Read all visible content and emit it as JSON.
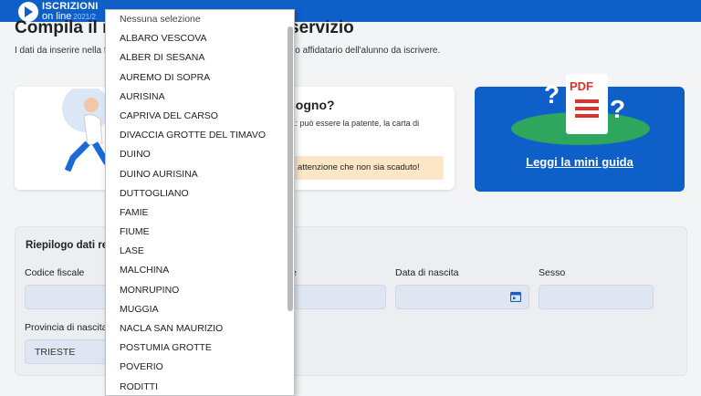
{
  "header": {
    "logo_line1": "ISCRIZIONI",
    "logo_line2": "on line",
    "logo_year": "2021/2"
  },
  "page": {
    "title_left": "Compila il m",
    "title_right": "servizio",
    "subtitle_left": "I dati da inserire nella f",
    "subtitle_right": "ore o affidatario dell'alunno da iscrivere."
  },
  "info": {
    "title": "sogno?",
    "text": "tà: può essere la patente, la carta di",
    "text2": "",
    "warning": "ai attenzione che non sia scaduto!"
  },
  "guide": {
    "link": "Leggi la mini guida",
    "pdf_label": "PDF"
  },
  "summary": {
    "title": "Riepilogo dati reg",
    "codice_fiscale_label": "Codice fiscale",
    "cognome_label_fragment": "e",
    "data_nascita_label": "Data di nascita",
    "sesso_label": "Sesso",
    "provincia_label": "Provincia di nascita",
    "provincia_value": "TRIESTE"
  },
  "dropdown": {
    "options": [
      "Nessuna selezione",
      "ALBARO VESCOVA",
      "ALBER DI SESANA",
      "AUREMO DI SOPRA",
      "AURISINA",
      "CAPRIVA DEL CARSO",
      "DIVACCIA GROTTE DEL TIMAVO",
      "DUINO",
      "DUINO AURISINA",
      "DUTTOGLIANO",
      "FAMIE",
      "FIUME",
      "LASE",
      "MALCHINA",
      "MONRUPINO",
      "MUGGIA",
      "NACLA SAN MAURIZIO",
      "POSTUMIA GROTTE",
      "POVERIO",
      "RODITTI"
    ]
  },
  "colors": {
    "brand_blue": "#0f5fc9",
    "warning_bg": "#fbe7c6",
    "input_bg": "#dfe6f2"
  },
  "icons": [
    "logo-arrow-icon",
    "calendar-icon",
    "pdf-document-icon",
    "question-mark-icon"
  ]
}
